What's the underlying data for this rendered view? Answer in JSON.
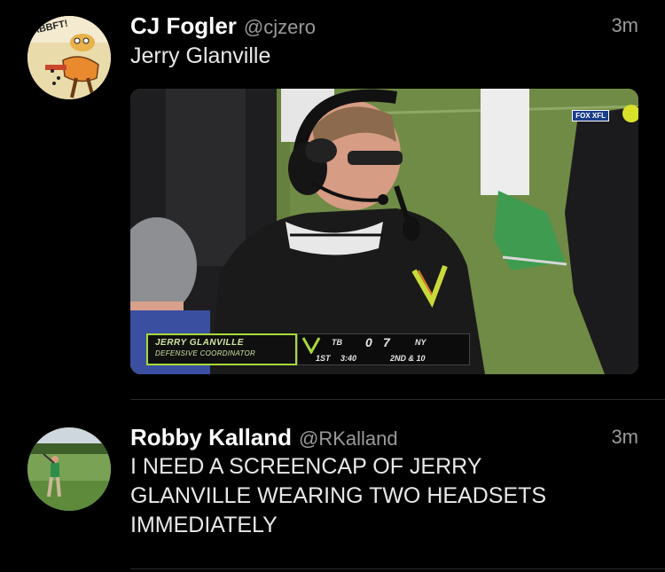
{
  "tweets": [
    {
      "name": "CJ Fogler",
      "handle": "@cjzero",
      "time": "3m",
      "text": "Jerry Glanville",
      "avatar": "cartoon-avatar",
      "media": {
        "lower_third_name": "JERRY GLANVILLE",
        "lower_third_title": "DEFENSIVE COORDINATOR",
        "team1": "TB",
        "team1_score": "0",
        "team2_score": "7",
        "team2": "NY",
        "quarter": "1ST",
        "clock": "3:40",
        "down": "2ND & 10",
        "network_bug": "FOX XFL"
      }
    },
    {
      "name": "Robby Kalland",
      "handle": "@RKalland",
      "time": "3m",
      "text_lines": [
        "I NEED A SCREENCAP OF JERRY",
        "GLANVILLE WEARING TWO HEADSETS",
        "IMMEDIATELY"
      ],
      "avatar": "golfer-avatar"
    }
  ],
  "colors": {
    "background": "#000000",
    "secondary_text": "#9a9a9a",
    "xfl_green": "#a7d83a"
  }
}
